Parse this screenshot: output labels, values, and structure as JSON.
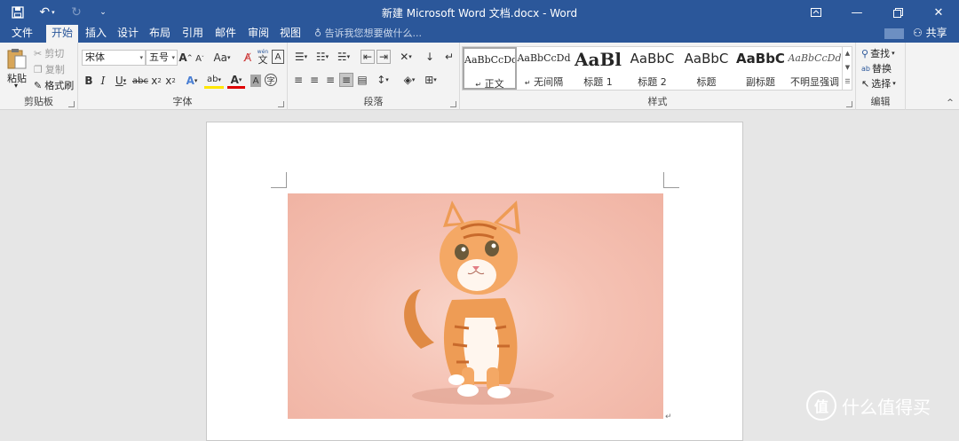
{
  "window": {
    "title": "新建 Microsoft Word 文档.docx - Word",
    "qat": {
      "save_icon": "save-icon",
      "undo_icon": "undo-icon",
      "redo_icon": "redo-icon",
      "customize_icon": "customize-qat-icon"
    }
  },
  "tabs": [
    {
      "label": "文件"
    },
    {
      "label": "开始"
    },
    {
      "label": "插入"
    },
    {
      "label": "设计"
    },
    {
      "label": "布局"
    },
    {
      "label": "引用"
    },
    {
      "label": "邮件"
    },
    {
      "label": "审阅"
    },
    {
      "label": "视图"
    }
  ],
  "tellme": "告诉我您想要做什么...",
  "share_label": "共享",
  "ribbon": {
    "clipboard": {
      "label": "剪贴板",
      "paste": "粘贴",
      "cut": "剪切",
      "copy": "复制",
      "format_painter": "格式刷"
    },
    "font": {
      "label": "字体",
      "font_name": "宋体",
      "font_size": "五号",
      "change_case": "Aa",
      "wen": "wén",
      "wen_char": "文",
      "a_char": "A"
    },
    "paragraph": {
      "label": "段落"
    },
    "styles": {
      "label": "样式",
      "items": [
        {
          "preview": "AaBbCcDd",
          "name": "正文"
        },
        {
          "preview": "AaBbCcDd",
          "name": "无间隔"
        },
        {
          "preview": "AaBl",
          "name": "标题 1"
        },
        {
          "preview": "AaBbC",
          "name": "标题 2"
        },
        {
          "preview": "AaBbC",
          "name": "标题"
        },
        {
          "preview": "AaBbC",
          "name": "副标题"
        },
        {
          "preview": "AaBbCcDd",
          "name": "不明显强调"
        }
      ],
      "para_mark": "↵"
    },
    "editing": {
      "label": "编辑",
      "find": "查找",
      "replace": "替换",
      "select": "选择"
    }
  },
  "document": {
    "para_mark": "↵"
  },
  "watermark": {
    "text": "什么值得买",
    "logo": "值"
  },
  "colors": {
    "brand": "#2b579a",
    "ribbon_bg": "#f3f3f3"
  }
}
